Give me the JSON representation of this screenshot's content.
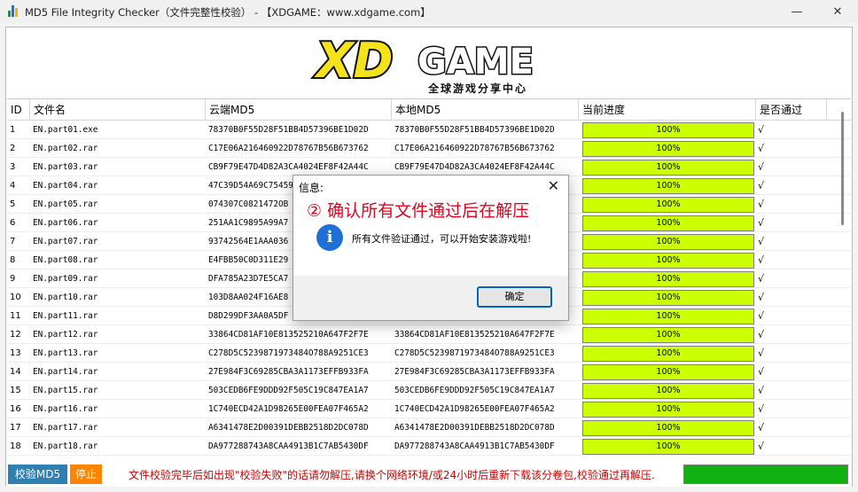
{
  "window": {
    "title": "MD5 File Integrity Checker（文件完整性校验） - 【XDGAME：www.xdgame.com】",
    "minimize_glyph": "—",
    "close_glyph": "✕"
  },
  "logo": {
    "brand": "XDGAME",
    "letters_left": "XD",
    "letters_right": "GAME",
    "tagline": "全球游戏分享中心"
  },
  "table": {
    "columns": {
      "id": "ID",
      "filename": "文件名",
      "cloud_md5": "云端MD5",
      "local_md5": "本地MD5",
      "progress": "当前进度",
      "passed": "是否通过"
    },
    "rows": [
      {
        "id": "1",
        "file": "EN.part01.exe",
        "cloud": "78370B0F55D28F51BB4D57396BE1D02D",
        "local": "78370B0F55D28F51BB4D57396BE1D02D",
        "progress": 1.0,
        "progress_label": "100%",
        "passed": "√"
      },
      {
        "id": "2",
        "file": "EN.part02.rar",
        "cloud": "C17E06A216460922D78767B56B673762",
        "local": "C17E06A216460922D78767B56B673762",
        "progress": 1.0,
        "progress_label": "100%",
        "passed": "√"
      },
      {
        "id": "3",
        "file": "EN.part03.rar",
        "cloud": "CB9F79E47D4D82A3CA4024EF8F42A44C",
        "local": "CB9F79E47D4D82A3CA4024EF8F42A44C",
        "progress": 1.0,
        "progress_label": "100%",
        "passed": "√"
      },
      {
        "id": "4",
        "file": "EN.part04.rar",
        "cloud": "47C39D54A69C75459",
        "local": "",
        "progress": 1.0,
        "progress_label": "100%",
        "passed": "√"
      },
      {
        "id": "5",
        "file": "EN.part05.rar",
        "cloud": "074307C0821472OB",
        "local": "",
        "progress": 1.0,
        "progress_label": "100%",
        "passed": "√"
      },
      {
        "id": "6",
        "file": "EN.part06.rar",
        "cloud": "251AA1C9895A99A7",
        "local": "",
        "progress": 1.0,
        "progress_label": "100%",
        "passed": "√"
      },
      {
        "id": "7",
        "file": "EN.part07.rar",
        "cloud": "93742564E1AAA036",
        "local": "",
        "progress": 1.0,
        "progress_label": "100%",
        "passed": "√"
      },
      {
        "id": "8",
        "file": "EN.part08.rar",
        "cloud": "E4FBB50C0D311E29",
        "local": "",
        "progress": 1.0,
        "progress_label": "100%",
        "passed": "√"
      },
      {
        "id": "9",
        "file": "EN.part09.rar",
        "cloud": "DFA785A23D7E5CA7",
        "local": "",
        "progress": 1.0,
        "progress_label": "100%",
        "passed": "√"
      },
      {
        "id": "10",
        "file": "EN.part10.rar",
        "cloud": "103D8AA024F16AE8",
        "local": "",
        "progress": 1.0,
        "progress_label": "100%",
        "passed": "√"
      },
      {
        "id": "11",
        "file": "EN.part11.rar",
        "cloud": "D8D299DF3AA0A5DF",
        "local": "",
        "progress": 1.0,
        "progress_label": "100%",
        "passed": "√"
      },
      {
        "id": "12",
        "file": "EN.part12.rar",
        "cloud": "33864CD81AF10E813525210A647F2F7E",
        "local": "33864CD81AF10E813525210A647F2F7E",
        "progress": 1.0,
        "progress_label": "100%",
        "passed": "√"
      },
      {
        "id": "13",
        "file": "EN.part13.rar",
        "cloud": "C278D5C5239871973484O788A9251CE3",
        "local": "C278D5C5239871973484O788A9251CE3",
        "progress": 1.0,
        "progress_label": "100%",
        "passed": "√"
      },
      {
        "id": "14",
        "file": "EN.part14.rar",
        "cloud": "27E984F3C69285CBA3A1173EFFB933FA",
        "local": "27E984F3C69285CBA3A1173EFFB933FA",
        "progress": 1.0,
        "progress_label": "100%",
        "passed": "√"
      },
      {
        "id": "15",
        "file": "EN.part15.rar",
        "cloud": "503CEDB6FE9DDD92F505C19C847EA1A7",
        "local": "503CEDB6FE9DDD92F505C19C847EA1A7",
        "progress": 1.0,
        "progress_label": "100%",
        "passed": "√"
      },
      {
        "id": "16",
        "file": "EN.part16.rar",
        "cloud": "1C740ECD42A1D98265E00FEA07F465A2",
        "local": "1C740ECD42A1D98265E00FEA07F465A2",
        "progress": 1.0,
        "progress_label": "100%",
        "passed": "√"
      },
      {
        "id": "17",
        "file": "EN.part17.rar",
        "cloud": "A6341478E2D00391DEBB2518D2DC078D",
        "local": "A6341478E2D00391DEBB2518D2DC078D",
        "progress": 1.0,
        "progress_label": "100%",
        "passed": "√"
      },
      {
        "id": "18",
        "file": "EN.part18.rar",
        "cloud": "DA977288743A8CAA4913B1C7AB5430DF",
        "local": "DA977288743A8CAA4913B1C7AB5430DF",
        "progress": 1.0,
        "progress_label": "100%",
        "passed": "√"
      }
    ]
  },
  "bottom": {
    "verify_label": "校验MD5",
    "stop_label": "停止",
    "notice": "文件校验完毕后如出现\"校验失败\"的话请勿解压,请换个网络环境/或24小时后重新下载该分卷包,校验通过再解压.",
    "overall_progress": 1.0
  },
  "dialog": {
    "title": "信息:",
    "close_glyph": "✕",
    "annotation": "② 确认所有文件通过后在解压",
    "info_glyph": "i",
    "message": "所有文件验证通过，可以开始安装游戏啦!",
    "ok_label": "确定"
  },
  "colors": {
    "progress_fill": "#ccff00",
    "overall_progress_fill": "#10b010",
    "verify_button": "#2f7fb1",
    "stop_button": "#ff8400",
    "notice_text": "#cc0000",
    "annotation_text": "#e8001c",
    "info_icon": "#1f6fd4",
    "logo_yellow": "#f4e21c"
  }
}
